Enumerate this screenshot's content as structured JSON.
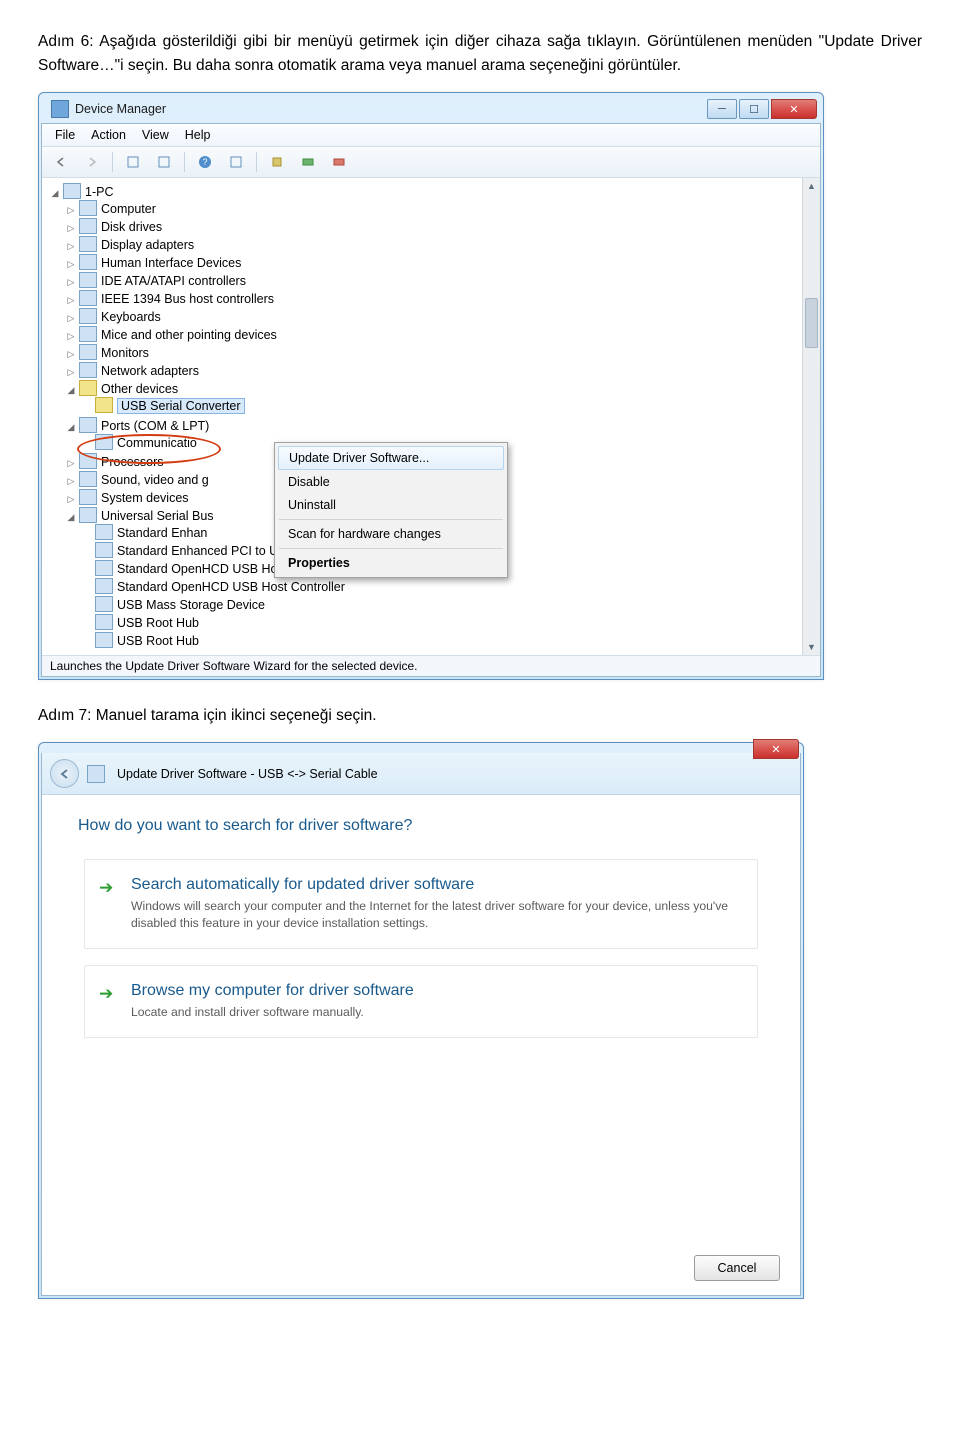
{
  "para1": "Adım 6: Aşağıda gösterildiği gibi bir menüyü getirmek için diğer cihaza sağa tıklayın. Görüntülenen menüden \"Update Driver Software…\"i seçin. Bu daha sonra otomatik arama veya manuel arama seçeneğini görüntüler.",
  "dm": {
    "title": "Device Manager",
    "menus": [
      "File",
      "Action",
      "View",
      "Help"
    ],
    "root": "1-PC",
    "items": [
      "Computer",
      "Disk drives",
      "Display adapters",
      "Human Interface Devices",
      "IDE ATA/ATAPI controllers",
      "IEEE 1394 Bus host controllers",
      "Keyboards",
      "Mice and other pointing devices",
      "Monitors",
      "Network adapters"
    ],
    "other_devices": "Other devices",
    "usb_serial": "USB Serial Converter",
    "ports": "Ports (COM & LPT)",
    "ports_child": "Communicatio",
    "rest": [
      "Processors",
      "Sound, video and g",
      "System devices"
    ],
    "usbc": "Universal Serial Bus",
    "usb_children": [
      "Standard Enhan",
      "Standard Enhanced PCI to USB Host Controller",
      "Standard OpenHCD USB Host Controller",
      "Standard OpenHCD USB Host Controller",
      "USB Mass Storage Device",
      "USB Root Hub",
      "USB Root Hub"
    ],
    "ctx": {
      "update": "Update Driver Software...",
      "disable": "Disable",
      "uninstall": "Uninstall",
      "scan": "Scan for hardware changes",
      "props": "Properties"
    },
    "status": "Launches the Update Driver Software Wizard for the selected device."
  },
  "para2": "Adım 7: Manuel tarama için ikinci seçeneği seçin.",
  "dlg": {
    "title": "Update Driver Software - USB <-> Serial Cable",
    "heading": "How do you want to search for driver software?",
    "opt1t": "Search automatically for updated driver software",
    "opt1d": "Windows will search your computer and the Internet for the latest driver software for your device, unless you've disabled this feature in your device installation settings.",
    "opt2t": "Browse my computer for driver software",
    "opt2d": "Locate and install driver software manually.",
    "cancel": "Cancel"
  }
}
